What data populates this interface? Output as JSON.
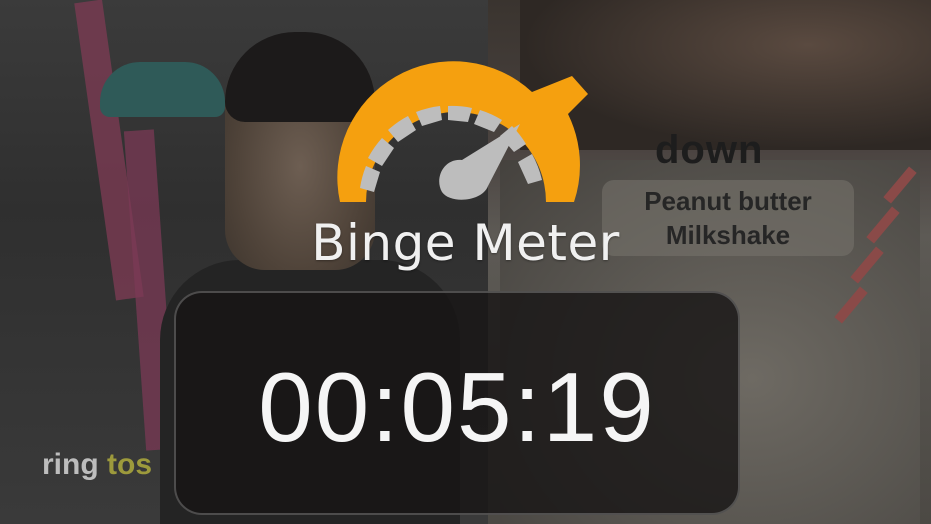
{
  "overlay": {
    "title": "Binge Meter",
    "timer": "00:05:19",
    "meter_color": "#F5A00F",
    "segment_color": "#BDBDBD",
    "needle_color": "#BDBDBD"
  },
  "background": {
    "word": "down",
    "product_label": "Peanut butter\nMilkshake",
    "caption_prefix": "ring ",
    "caption_highlight": "tos"
  }
}
